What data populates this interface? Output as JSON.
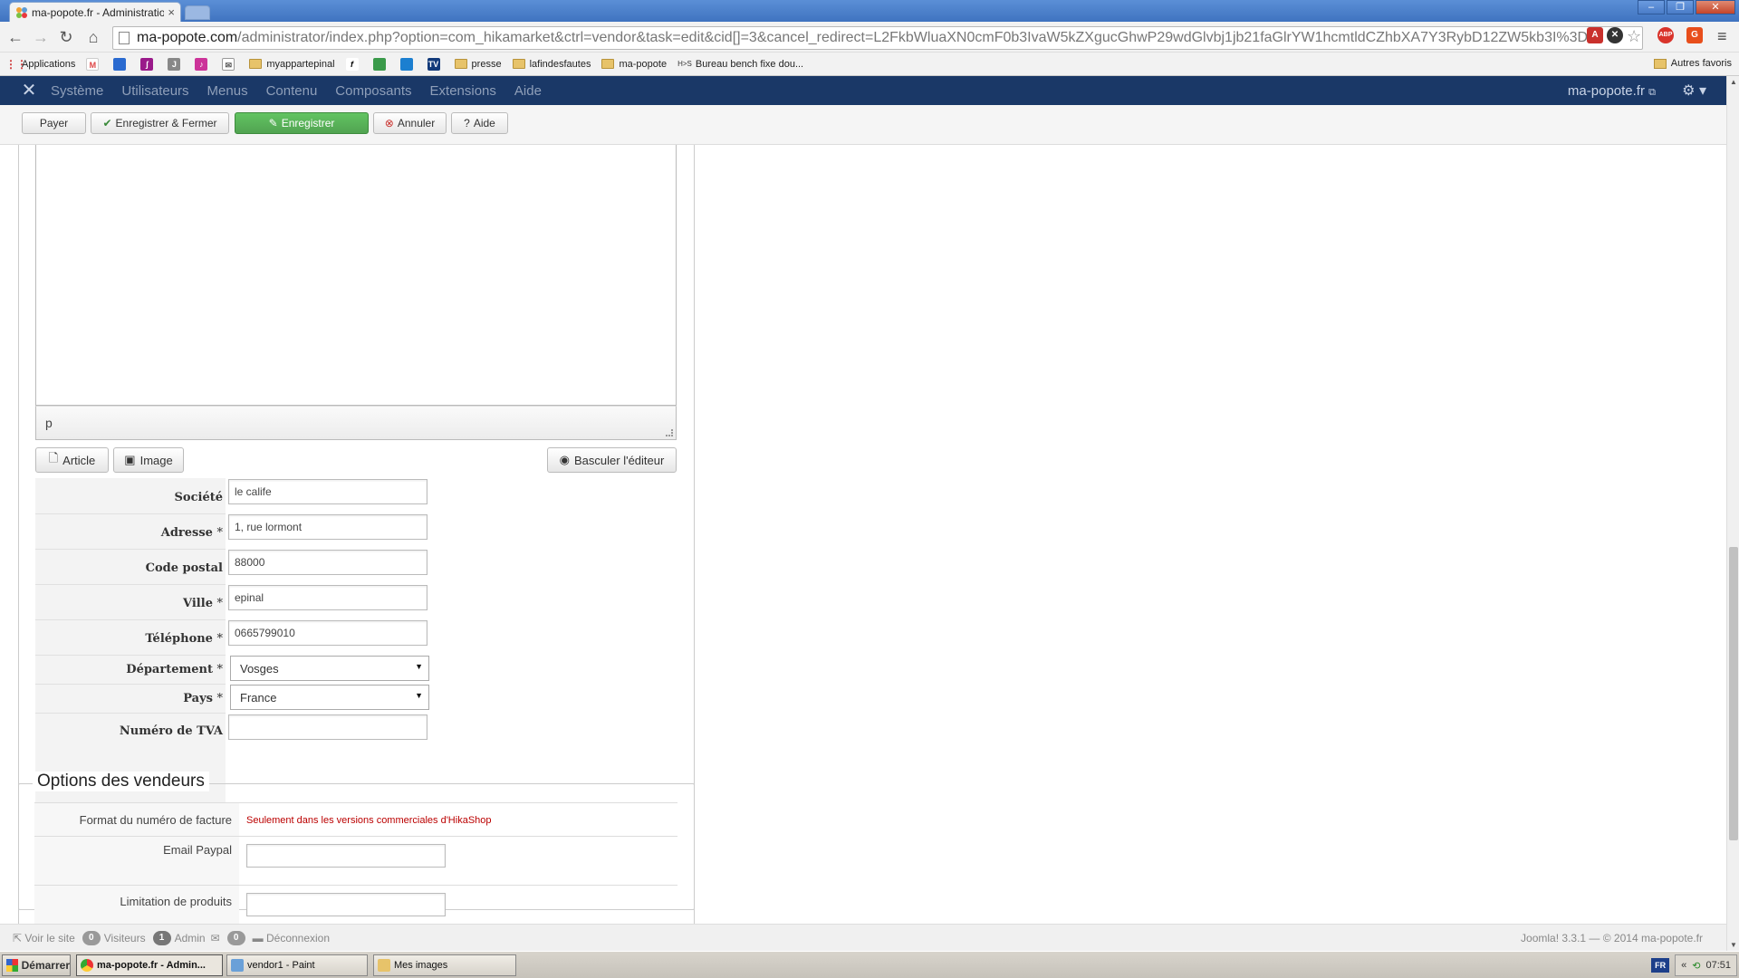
{
  "browser": {
    "tab_title": "ma-popote.fr - Administration",
    "url_host": "ma-popote.com",
    "url_path": "/administrator/index.php?option=com_hikamarket&ctrl=vendor&task=edit&cid[]=3&cancel_redirect=L2FkbWluaXN0cmF0b3IvaW5kZXgucGhwP29wdGlvbj1jb21faGlrYW1hcmtldCZhbXA7Y3RybD12ZW5kb3I%3D",
    "abp_label": "ABP",
    "bookmarks": [
      {
        "label": "Applications",
        "kind": "apps"
      },
      {
        "label": "",
        "kind": "gmail"
      },
      {
        "label": "",
        "kind": "icon-blue"
      },
      {
        "label": "",
        "kind": "icon-purple"
      },
      {
        "label": "",
        "kind": "icon-gray"
      },
      {
        "label": "",
        "kind": "icon-pink"
      },
      {
        "label": "",
        "kind": "mail"
      },
      {
        "label": "myappartepinal",
        "kind": "folder"
      },
      {
        "label": "",
        "kind": "icon-f"
      },
      {
        "label": "",
        "kind": "icon-maps"
      },
      {
        "label": "",
        "kind": "icon-drive"
      },
      {
        "label": "TV",
        "kind": "icon-tv"
      },
      {
        "label": "presse",
        "kind": "folder"
      },
      {
        "label": "lafindesfautes",
        "kind": "folder"
      },
      {
        "label": "ma-popote",
        "kind": "folder"
      },
      {
        "label": "Bureau bench fixe dou...",
        "kind": "hs"
      }
    ],
    "bookmark_hs_prefix": "H>S",
    "other_bookmarks": "Autres favoris"
  },
  "joomla": {
    "menu": [
      "Système",
      "Utilisateurs",
      "Menus",
      "Contenu",
      "Composants",
      "Extensions",
      "Aide"
    ],
    "site_link": "ma-popote.fr",
    "toolbar": {
      "pay": "Payer",
      "save_close": "Enregistrer & Fermer",
      "save": "Enregistrer",
      "cancel": "Annuler",
      "help": "Aide"
    }
  },
  "editor": {
    "status_path": "p",
    "btn_article": "Article",
    "btn_image": "Image",
    "btn_toggle": "Basculer l'éditeur"
  },
  "form": {
    "fields": [
      {
        "label": "Société",
        "required": false,
        "value": "le calife",
        "type": "input"
      },
      {
        "label": "Adresse",
        "required": true,
        "value": "1, rue lormont",
        "type": "input"
      },
      {
        "label": "Code postal",
        "required": false,
        "value": "88000",
        "type": "input"
      },
      {
        "label": "Ville",
        "required": true,
        "value": "epinal",
        "type": "input"
      },
      {
        "label": "Téléphone",
        "required": true,
        "value": "0665799010",
        "type": "input"
      },
      {
        "label": "Département",
        "required": true,
        "value": "Vosges",
        "type": "select"
      },
      {
        "label": "Pays",
        "required": true,
        "value": "France",
        "type": "select"
      },
      {
        "label": "Numéro de TVA",
        "required": false,
        "value": "",
        "type": "input"
      }
    ],
    "required_mark": "*"
  },
  "vendor_options": {
    "legend": "Options des vendeurs",
    "invoice_label": "Format du numéro de facture",
    "invoice_note": "Seulement dans les versions commerciales d'HikaShop",
    "paypal_label": "Email Paypal",
    "paypal_value": "",
    "product_limit_label": "Limitation de produits",
    "product_limit_value": ""
  },
  "status_bar": {
    "view_site": "Voir le site",
    "visitors_count": "0",
    "visitors_label": "Visiteurs",
    "admin_count": "1",
    "admin_label": "Admin",
    "messages_count": "0",
    "logout": "Déconnexion",
    "version": "Joomla! 3.3.1 — © 2014 ma-popote.fr"
  },
  "taskbar": {
    "start": "Démarrer",
    "tasks": [
      "ma-popote.fr - Admin...",
      "vendor1 - Paint",
      "Mes images"
    ],
    "lang": "FR",
    "tray_arrows": "«",
    "time": "07:51"
  },
  "colors": {
    "joomla_nav": "#1a3867",
    "save_green": "#51a351",
    "note_red": "#bb0000"
  }
}
